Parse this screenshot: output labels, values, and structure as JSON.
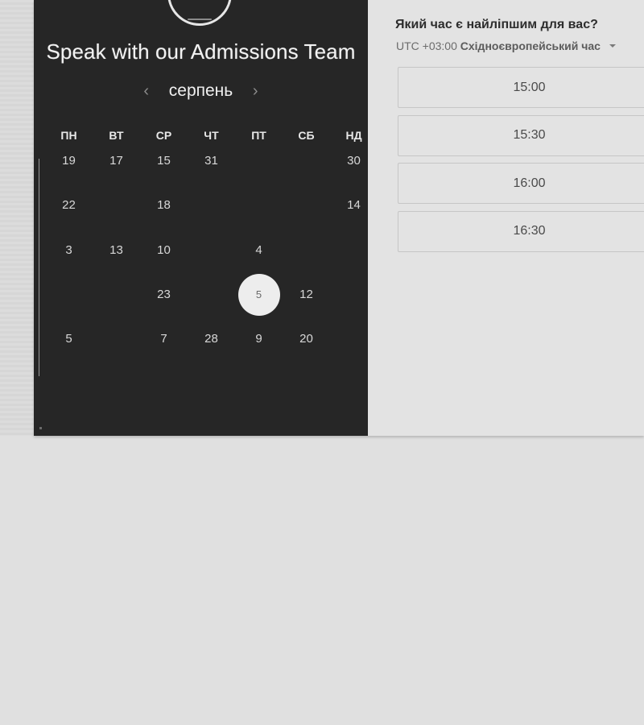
{
  "calendar": {
    "title": "Speak with our Admissions Team",
    "month": "серпень",
    "prev_icon": "chevron-left-icon",
    "next_icon": "chevron-right-icon",
    "weekdays": [
      "ПН",
      "ВТ",
      "СР",
      "ЧТ",
      "ПТ",
      "СБ",
      "НД"
    ],
    "weeks": [
      [
        {
          "d": "19",
          "dim": false
        },
        {
          "d": "17",
          "dim": false
        },
        {
          "d": "15",
          "dim": false
        },
        {
          "d": "31",
          "dim": false
        },
        {
          "d": "",
          "dim": true
        },
        {
          "d": "",
          "dim": true
        },
        {
          "d": "30",
          "dim": false
        }
      ],
      [
        {
          "d": "22",
          "dim": false
        },
        {
          "d": "",
          "dim": true
        },
        {
          "d": "18",
          "dim": false
        },
        {
          "d": "",
          "dim": true
        },
        {
          "d": "",
          "dim": true
        },
        {
          "d": "",
          "dim": true
        },
        {
          "d": "14",
          "dim": false
        }
      ],
      [
        {
          "d": "3",
          "dim": false
        },
        {
          "d": "13",
          "dim": false
        },
        {
          "d": "10",
          "dim": false
        },
        {
          "d": "",
          "dim": true
        },
        {
          "d": "4",
          "dim": false
        },
        {
          "d": "",
          "dim": true
        },
        {
          "d": "",
          "dim": true
        }
      ],
      [
        {
          "d": "",
          "dim": true
        },
        {
          "d": "",
          "dim": true
        },
        {
          "d": "23",
          "dim": false
        },
        {
          "d": "",
          "dim": true
        },
        {
          "d": "5",
          "dim": false,
          "selected": true
        },
        {
          "d": "12",
          "dim": false
        },
        {
          "d": "",
          "dim": true
        }
      ],
      [
        {
          "d": "5",
          "dim": false
        },
        {
          "d": "",
          "dim": true
        },
        {
          "d": "7",
          "dim": false
        },
        {
          "d": "28",
          "dim": false
        },
        {
          "d": "9",
          "dim": false
        },
        {
          "d": "20",
          "dim": false
        },
        {
          "d": "",
          "dim": true
        }
      ]
    ]
  },
  "times": {
    "question": "Який час є найліпшим для вас?",
    "tz_offset": "UTC +03:00",
    "tz_name": "Східноєвропейський час",
    "slots": [
      "15:00",
      "15:30",
      "16:00",
      "16:30"
    ]
  }
}
